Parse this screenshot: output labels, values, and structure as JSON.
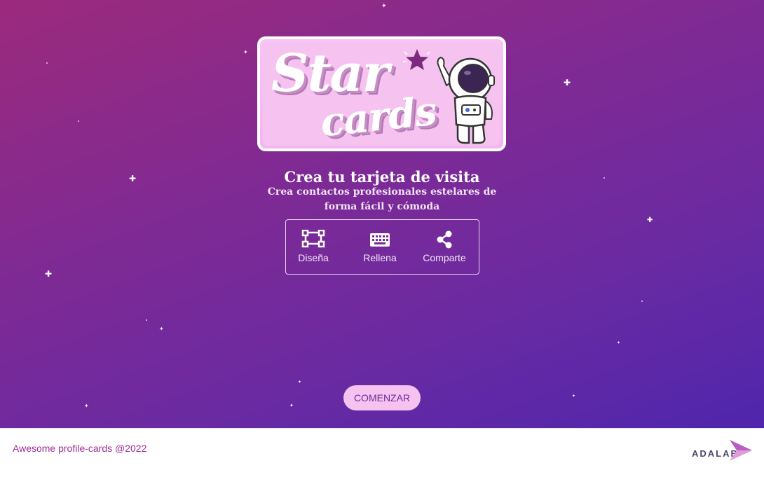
{
  "hero": {
    "logo": {
      "line1": "Star",
      "line2": "cards"
    },
    "title": "Crea tu tarjeta de visita",
    "subtitle": "Crea contactos profesionales estelares de forma fácil y cómoda"
  },
  "steps": [
    {
      "label": "Diseña",
      "icon": "design-icon"
    },
    {
      "label": "Rellena",
      "icon": "keyboard-icon"
    },
    {
      "label": "Comparte",
      "icon": "share-icon"
    }
  ],
  "cta": {
    "label": "COMENZAR"
  },
  "footer": {
    "copyright": "Awesome profile-cards @2022",
    "brand": "ADALAB"
  },
  "colors": {
    "gradient_start": "#9c2a7c",
    "gradient_end": "#4f26ac",
    "button_bg": "#f6c3f1",
    "button_text": "#6c2a93",
    "footer_text": "#9b2e96"
  }
}
